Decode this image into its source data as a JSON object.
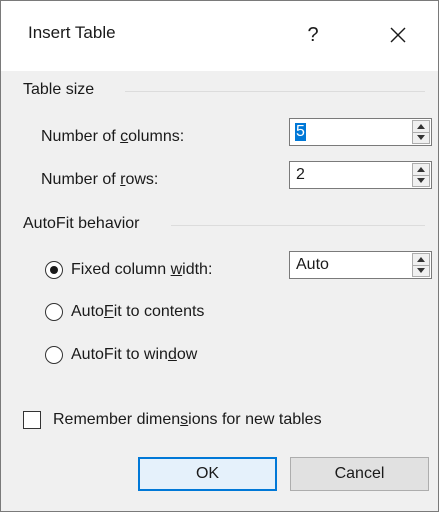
{
  "dialog": {
    "title": "Insert Table",
    "help_glyph": "?",
    "close_glyph": "close-icon"
  },
  "table_size": {
    "header": "Table size",
    "columns": {
      "label_pre": "Number of ",
      "label_key": "c",
      "label_post": "olumns:",
      "value": "5"
    },
    "rows": {
      "label_pre": "Number of ",
      "label_key": "r",
      "label_post": "ows:",
      "value": "2"
    }
  },
  "autofit": {
    "header": "AutoFit behavior",
    "fixed": {
      "label_pre": "Fixed column ",
      "label_key": "w",
      "label_post": "idth:",
      "value": "Auto",
      "selected": true
    },
    "contents": {
      "label_pre": "Auto",
      "label_key": "F",
      "label_post": "it to contents",
      "selected": false
    },
    "window": {
      "label_pre": "AutoFit to win",
      "label_key": "d",
      "label_post": "ow",
      "selected": false
    }
  },
  "remember": {
    "label_pre": "Remember dimen",
    "label_key": "s",
    "label_post": "ions for new tables",
    "checked": false
  },
  "buttons": {
    "ok": "OK",
    "cancel": "Cancel"
  },
  "colors": {
    "accent": "#0078d7",
    "content_bg": "#f0f0f0",
    "title_bg": "#ffffff"
  }
}
